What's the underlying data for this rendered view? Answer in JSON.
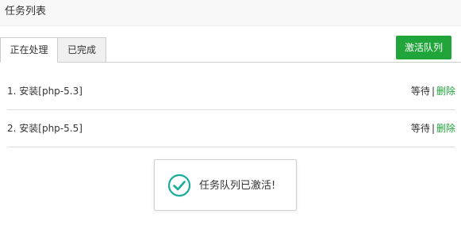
{
  "window": {
    "title": "任务列表"
  },
  "tabs": [
    {
      "label": "正在处理",
      "active": true
    },
    {
      "label": "已完成",
      "active": false
    }
  ],
  "toolbar": {
    "activate_label": "激活队列"
  },
  "tasks": [
    {
      "name": "1. 安装[php-5.3]",
      "status": "等待",
      "separator": "|",
      "delete_label": "删除"
    },
    {
      "name": "2. 安装[php-5.5]",
      "status": "等待",
      "separator": "|",
      "delete_label": "删除"
    }
  ],
  "toast": {
    "message": "任务队列已激活!",
    "icon": "check-circle-icon"
  },
  "colors": {
    "accent": "#20a53a",
    "success_icon": "#1aab9b",
    "title_bar_bg": "#f8f8f8"
  }
}
